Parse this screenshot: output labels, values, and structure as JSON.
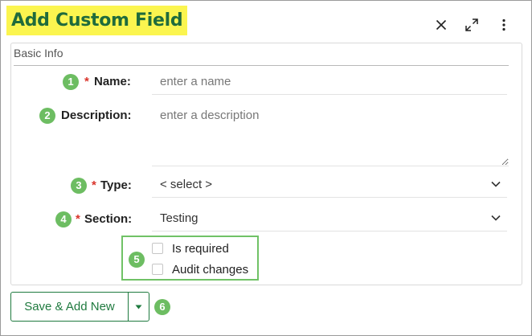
{
  "dialog": {
    "title": "Add Custom Field"
  },
  "section": {
    "title": "Basic Info"
  },
  "fields": {
    "name": {
      "badge": "1",
      "required_mark": "*",
      "label": "Name:",
      "placeholder": "enter a name"
    },
    "description": {
      "badge": "2",
      "label": "Description:",
      "placeholder": "enter a description"
    },
    "type": {
      "badge": "3",
      "required_mark": "*",
      "label": "Type:",
      "value": "< select >"
    },
    "section": {
      "badge": "4",
      "required_mark": "*",
      "label": "Section:",
      "value": "Testing"
    }
  },
  "options": {
    "badge": "5",
    "is_required": {
      "label": "Is required",
      "checked": false
    },
    "audit_changes": {
      "label": "Audit changes",
      "checked": false
    }
  },
  "footer": {
    "save_add_new_label": "Save & Add New",
    "badge": "6"
  },
  "icons": {
    "close": "close-icon",
    "expand": "expand-icon",
    "more": "more-vertical-icon",
    "chevron": "chevron-down-icon",
    "caret": "caret-down-icon"
  },
  "colors": {
    "title_highlight": "#fbf54f",
    "title_text": "#1f6b3c",
    "badge": "#6dbd62",
    "required": "#d9342b",
    "primary_green": "#1f7a3f"
  }
}
